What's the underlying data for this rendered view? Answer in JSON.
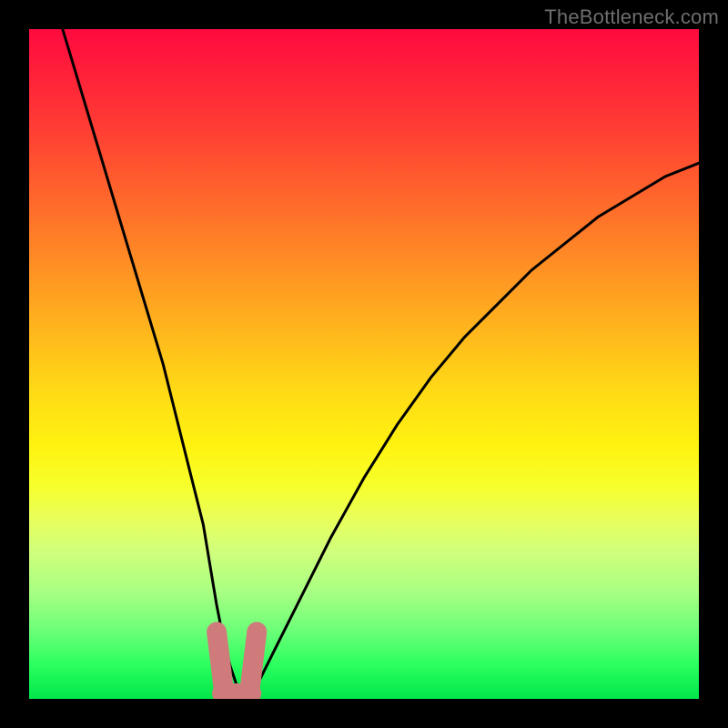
{
  "watermark": "TheBottleneck.com",
  "chart_data": {
    "type": "line",
    "title": "",
    "xlabel": "",
    "ylabel": "",
    "xlim": [
      0,
      100
    ],
    "ylim": [
      0,
      100
    ],
    "grid": false,
    "legend": false,
    "series": [
      {
        "name": "bottleneck-curve",
        "x": [
          5,
          8,
          11,
          14,
          17,
          20,
          22,
          24,
          26,
          27,
          28,
          29,
          30,
          31,
          32,
          33,
          34,
          35,
          37,
          40,
          45,
          50,
          55,
          60,
          65,
          70,
          75,
          80,
          85,
          90,
          95,
          100
        ],
        "y": [
          100,
          90,
          80,
          70,
          60,
          50,
          42,
          34,
          26,
          20,
          14,
          9,
          5,
          2,
          1,
          1,
          2,
          4,
          8,
          14,
          24,
          33,
          41,
          48,
          54,
          59,
          64,
          68,
          72,
          75,
          78,
          80
        ]
      }
    ],
    "highlight_region": {
      "name": "optimal-zone-marker",
      "x_range": [
        28,
        34
      ],
      "y_range": [
        0,
        10
      ],
      "color": "#cf7b7b"
    },
    "background_gradient": {
      "top_color": "#ff0a3f",
      "bottom_color": "#00e64a",
      "meaning": "red = high bottleneck, green = low bottleneck"
    }
  }
}
